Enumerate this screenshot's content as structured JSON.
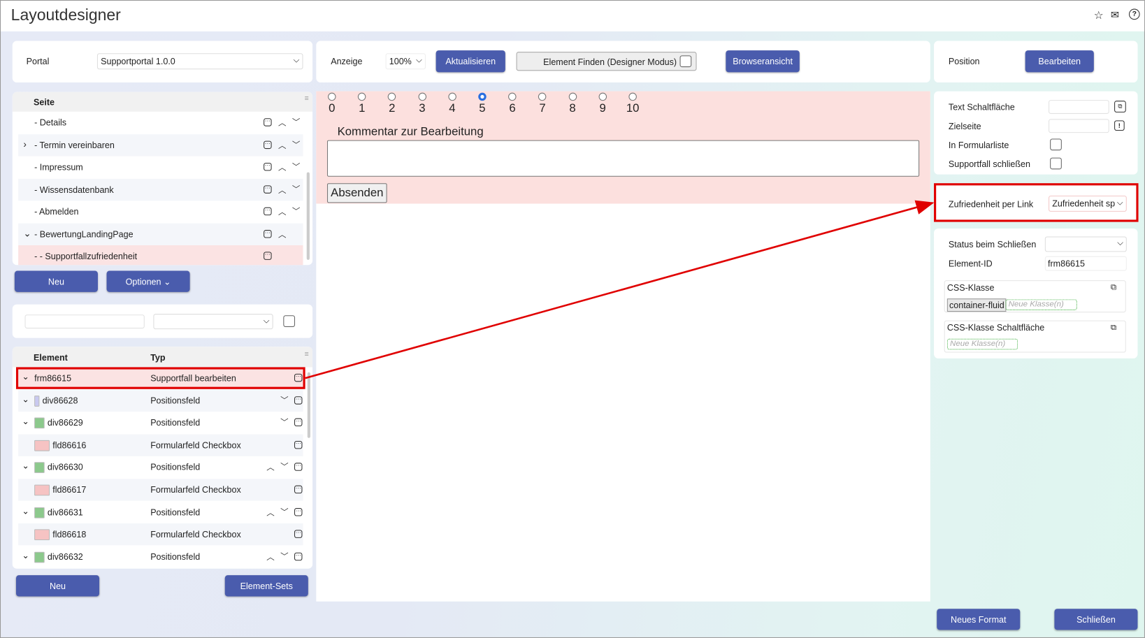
{
  "app": {
    "title": "Layoutdesigner",
    "icons": [
      "star-icon",
      "mail-icon",
      "help-icon"
    ]
  },
  "portal": {
    "label": "Portal",
    "value": "Supportportal 1.0.0"
  },
  "page_tree": {
    "header": "Seite",
    "items": [
      {
        "label": "- Details",
        "toggle": "",
        "up": true,
        "down": true
      },
      {
        "label": "- Termin vereinbaren",
        "toggle": "›",
        "up": true,
        "down": true
      },
      {
        "label": "- Impressum",
        "toggle": "",
        "up": true,
        "down": true
      },
      {
        "label": "- Wissensdatenbank",
        "toggle": "",
        "up": true,
        "down": true
      },
      {
        "label": "- Abmelden",
        "toggle": "",
        "up": true,
        "down": true
      },
      {
        "label": "- BewertungLandingPage",
        "toggle": "⌄",
        "up": true,
        "down": false
      },
      {
        "label": "- - Supportfallzufriedenheit",
        "toggle": "",
        "up": false,
        "down": false,
        "selected": true
      }
    ]
  },
  "page_buttons": {
    "new": "Neu",
    "options": "Optionen ⌄"
  },
  "element_table": {
    "col_element": "Element",
    "col_type": "Typ",
    "rows": [
      {
        "id": "frm86615",
        "type": "Supportfall bearbeiten",
        "swatch": "",
        "selected": true
      },
      {
        "id": "div86628",
        "type": "Positionsfeld",
        "swatch": "#c9c9f0"
      },
      {
        "id": "div86629",
        "type": "Positionsfeld",
        "swatch": "#8cc98c"
      },
      {
        "id": "fld86616",
        "type": "Formularfeld Checkbox",
        "swatch": "#f6c3c3"
      },
      {
        "id": "div86630",
        "type": "Positionsfeld",
        "swatch": "#8cc98c"
      },
      {
        "id": "fld86617",
        "type": "Formularfeld Checkbox",
        "swatch": "#f6c3c3"
      },
      {
        "id": "div86631",
        "type": "Positionsfeld",
        "swatch": "#8cc98c"
      },
      {
        "id": "fld86618",
        "type": "Formularfeld Checkbox",
        "swatch": "#f6c3c3"
      },
      {
        "id": "div86632",
        "type": "Positionsfeld",
        "swatch": "#8cc98c"
      }
    ]
  },
  "element_buttons": {
    "new": "Neu",
    "sets": "Element-Sets"
  },
  "toolbar": {
    "display_label": "Anzeige",
    "zoom": "100%",
    "refresh": "Aktualisieren",
    "find": "Element Finden (Designer Modus)",
    "browser": "Browseransicht"
  },
  "canvas": {
    "scale": [
      "0",
      "1",
      "2",
      "3",
      "4",
      "5",
      "6",
      "7",
      "8",
      "9",
      "10"
    ],
    "selected": "5",
    "comment_label": "Kommentar zur Bearbeitung",
    "comment_value": "",
    "submit": "Absenden"
  },
  "right": {
    "position_label": "Position",
    "edit": "Bearbeiten",
    "text_button": "Text Schaltfläche",
    "target_page": "Zielseite",
    "in_form_list": "In Formularliste",
    "close_case": "Supportfall schließen",
    "satisfaction_label": "Zufriedenheit per Link",
    "satisfaction_value": "Zufriedenheit sp",
    "status_label": "Status beim Schließen",
    "status_value": "",
    "element_id_label": "Element-ID",
    "element_id": "frm86615",
    "css_class_label": "CSS-Klasse",
    "css_tag": "container-fluid",
    "css_placeholder": "Neue Klasse(n)",
    "css_button_label": "CSS-Klasse Schaltfläche",
    "css_button_placeholder": "Neue Klasse(n)"
  },
  "footer": {
    "new_format": "Neues Format",
    "close": "Schließen"
  },
  "colors": {
    "button": "#4a5cad",
    "highlight": "#e00000",
    "selected_row": "#fbe3e3"
  }
}
